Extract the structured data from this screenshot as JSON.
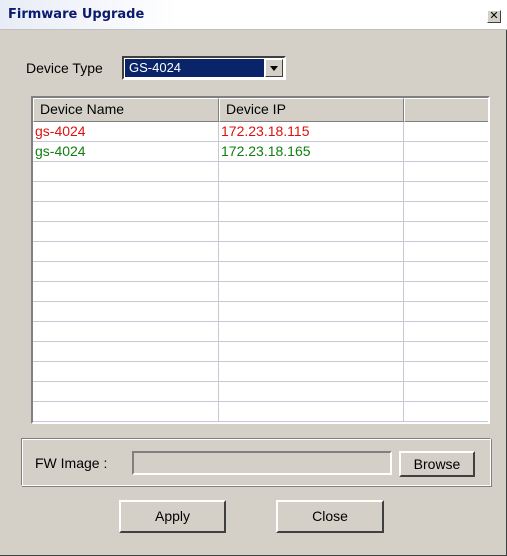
{
  "window": {
    "title": "Firmware Upgrade",
    "close_glyph": "✕"
  },
  "device_type": {
    "label": "Device Type",
    "selected": "GS-4024"
  },
  "table": {
    "columns": [
      "Device Name",
      "Device IP",
      ""
    ],
    "rows": [
      {
        "name": "gs-4024",
        "ip": "172.23.18.115",
        "color": "#e01010"
      },
      {
        "name": "gs-4024",
        "ip": "172.23.18.165",
        "color": "#108010"
      }
    ],
    "empty_row_count": 13
  },
  "fw_image": {
    "label": "FW Image :",
    "value": "",
    "browse_label": "Browse"
  },
  "actions": {
    "apply_label": "Apply",
    "close_label": "Close"
  }
}
